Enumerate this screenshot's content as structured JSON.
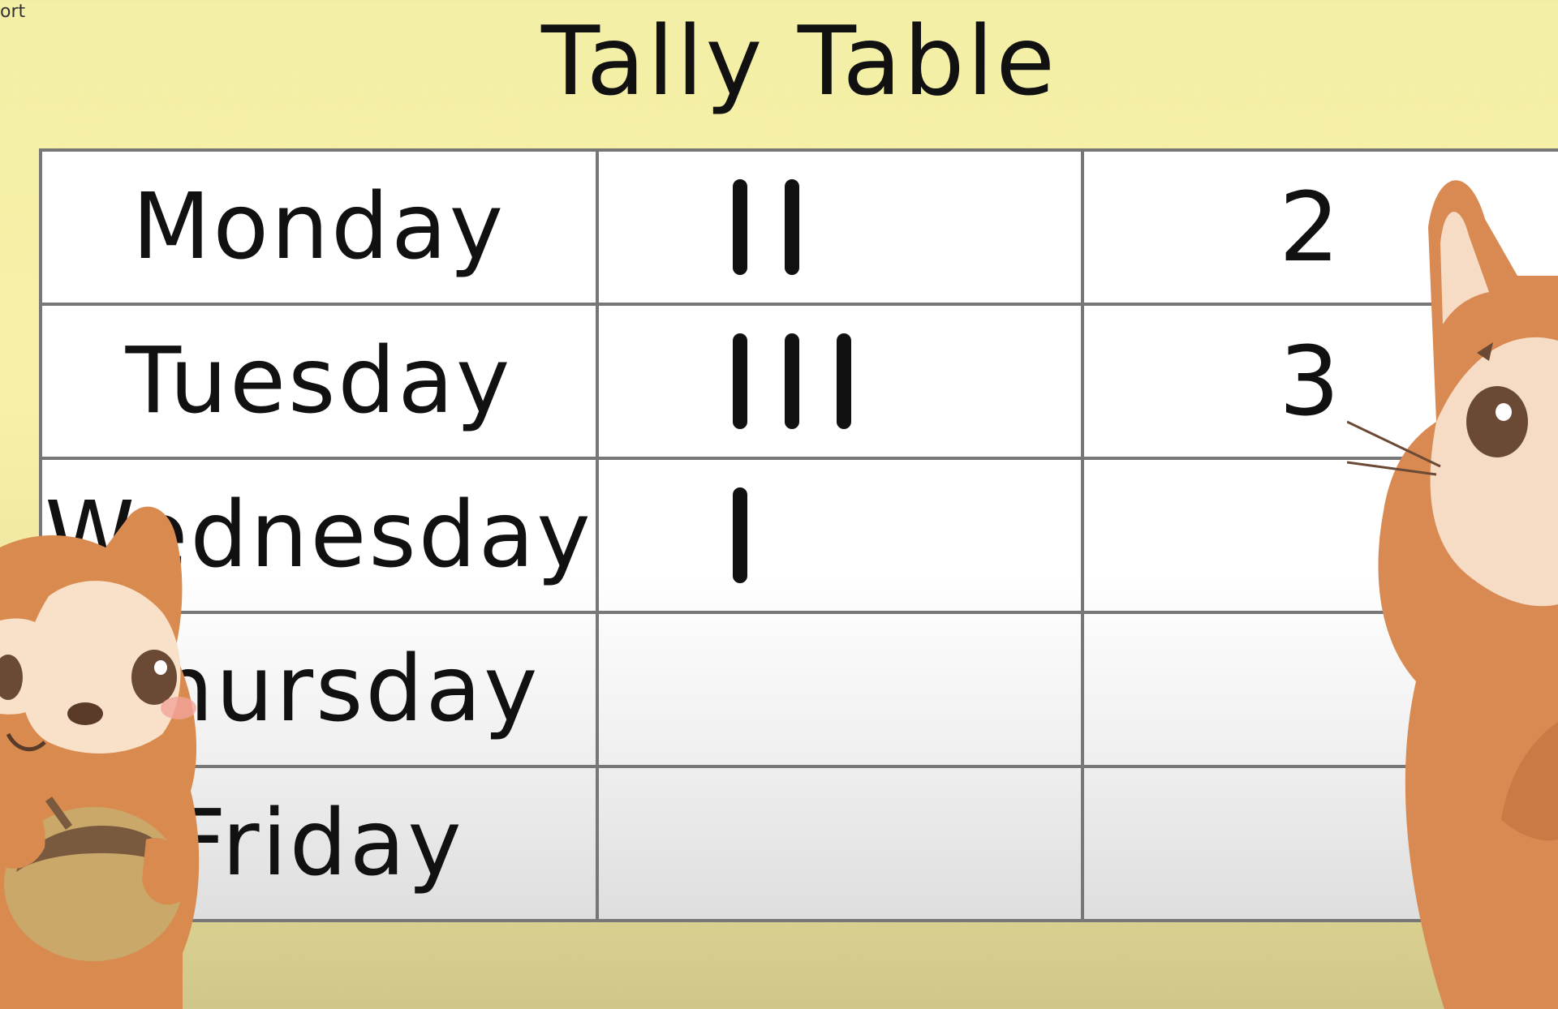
{
  "corner_text": "ort",
  "title": "Tally Table",
  "rows": [
    {
      "day": "Monday",
      "tally_count": 2,
      "number": "2"
    },
    {
      "day": "Tuesday",
      "tally_count": 3,
      "number": "3"
    },
    {
      "day": "Wednesday",
      "tally_count": 1,
      "number": ""
    },
    {
      "day": "Thursday",
      "tally_count": 0,
      "number": ""
    },
    {
      "day": "Friday",
      "tally_count": 0,
      "number": ""
    }
  ],
  "colors": {
    "background": "#f4efa6",
    "table_border": "#777777",
    "squirrel_orange": "#d98b4f",
    "cat_orange": "#d88a52"
  },
  "illustrations": [
    "squirrel-with-acorn",
    "cat"
  ]
}
